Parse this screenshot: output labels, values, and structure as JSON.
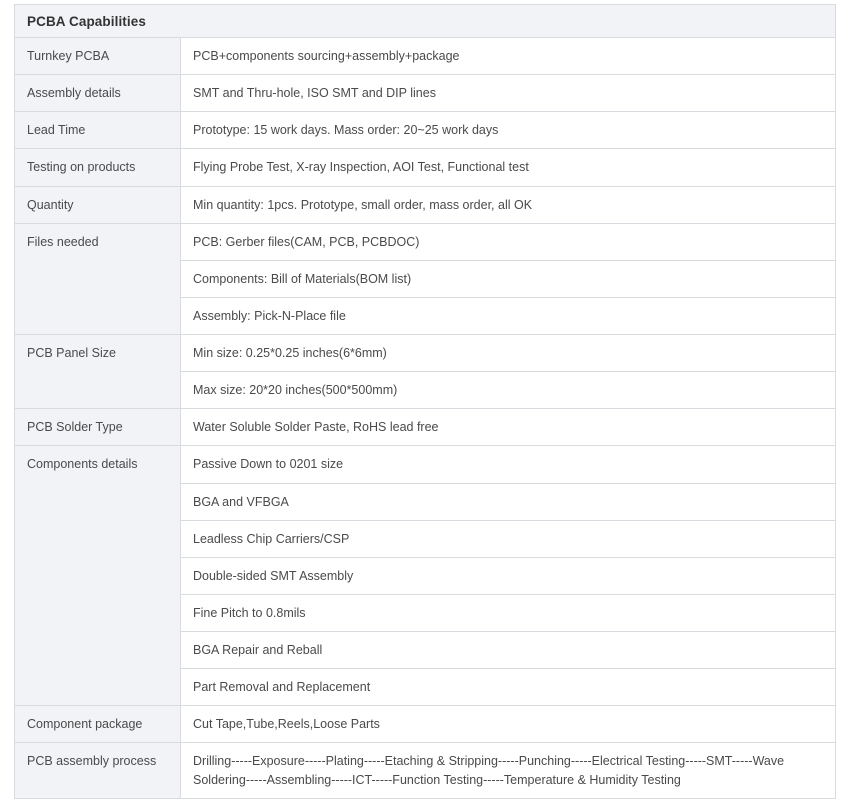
{
  "table": {
    "title": "PCBA Capabilities",
    "rows": [
      {
        "label": "Turnkey PCBA",
        "values": [
          "PCB+components sourcing+assembly+package"
        ]
      },
      {
        "label": "Assembly details",
        "values": [
          "SMT and Thru-hole, ISO SMT and DIP lines"
        ]
      },
      {
        "label": "Lead Time",
        "values": [
          "Prototype: 15 work days. Mass order: 20~25 work days"
        ]
      },
      {
        "label": "Testing on products",
        "values": [
          "Flying Probe Test, X-ray Inspection, AOI Test, Functional test"
        ]
      },
      {
        "label": "Quantity",
        "values": [
          "Min quantity: 1pcs. Prototype, small order, mass order, all OK"
        ]
      },
      {
        "label": "Files needed",
        "values": [
          "PCB: Gerber files(CAM, PCB, PCBDOC)",
          "Components: Bill of Materials(BOM list)",
          "Assembly: Pick-N-Place file"
        ]
      },
      {
        "label": "PCB Panel Size",
        "values": [
          "Min size: 0.25*0.25 inches(6*6mm)",
          "Max size: 20*20 inches(500*500mm)"
        ]
      },
      {
        "label": "PCB Solder Type",
        "values": [
          "Water Soluble Solder Paste, RoHS lead free"
        ]
      },
      {
        "label": "Components details",
        "values": [
          "Passive Down to 0201 size",
          "BGA and VFBGA",
          "Leadless Chip Carriers/CSP",
          "Double-sided SMT Assembly",
          "Fine Pitch to 0.8mils",
          "BGA Repair and Reball",
          "Part Removal and Replacement"
        ]
      },
      {
        "label": "Component package",
        "values": [
          "Cut Tape,Tube,Reels,Loose Parts"
        ]
      },
      {
        "label": "PCB assembly process",
        "values": [
          "Drilling-----Exposure-----Plating-----Etaching & Stripping-----Punching-----Electrical Testing-----SMT-----Wave Soldering-----Assembling-----ICT-----Function Testing-----Temperature & Humidity Testing"
        ]
      }
    ]
  },
  "colors": {
    "header_bg": "#f2f3f7",
    "label_bg": "#f2f3f7",
    "value_bg": "#ffffff",
    "border": "#d8dbe0",
    "title_text": "#333333",
    "body_text": "#4a4a4a"
  }
}
